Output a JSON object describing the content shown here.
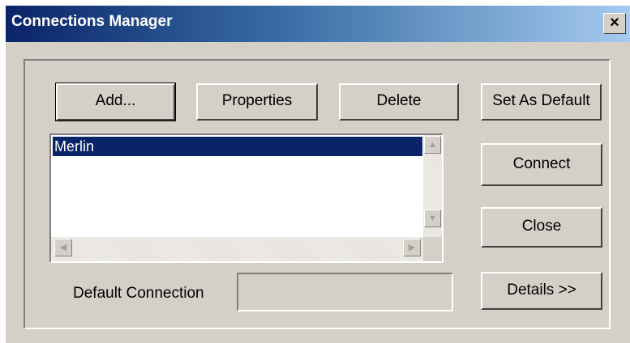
{
  "window": {
    "title": "Connections Manager",
    "close_glyph": "×"
  },
  "buttons": {
    "add": "Add...",
    "properties": "Properties",
    "delete": "Delete",
    "set_default": "Set As Default",
    "connect": "Connect",
    "close": "Close",
    "details": "Details >>"
  },
  "connections_list": {
    "items": [
      "Merlin"
    ],
    "selected_index": 0
  },
  "default_connection": {
    "label": "Default Connection",
    "value": ""
  },
  "icons": {
    "scroll_up": "▲",
    "scroll_down": "▼",
    "scroll_left": "◀",
    "scroll_right": "▶"
  },
  "colors": {
    "title_start": "#0a246a",
    "title_end": "#a6caf0",
    "selection": "#0a246a",
    "face": "#d4d0c8"
  }
}
